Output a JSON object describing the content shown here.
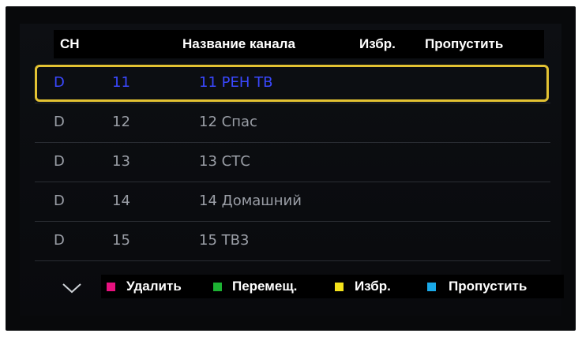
{
  "header": {
    "ch": "CH",
    "name": "Название канала",
    "fav": "Избр.",
    "skip": "Пропустить"
  },
  "icons": {
    "up": "chevron-up-icon",
    "down": "chevron-down-icon"
  },
  "channels": [
    {
      "type": "D",
      "number": "11",
      "name": "11 РЕН ТВ"
    },
    {
      "type": "D",
      "number": "12",
      "name": "12 Спас"
    },
    {
      "type": "D",
      "number": "13",
      "name": "13 СТС"
    },
    {
      "type": "D",
      "number": "14",
      "name": "14 Домашний"
    },
    {
      "type": "D",
      "number": "15",
      "name": "15 ТВ3"
    }
  ],
  "selected_index": 0,
  "legend": [
    {
      "label": "Удалить",
      "color": "#e8117f"
    },
    {
      "label": "Перемещ.",
      "color": "#1db233"
    },
    {
      "label": "Избр.",
      "color": "#f4e21b"
    },
    {
      "label": "Пропустить",
      "color": "#1aa9e8"
    }
  ],
  "colors": {
    "selection_border": "#e3c233",
    "selected_text": "#3a48ff"
  }
}
